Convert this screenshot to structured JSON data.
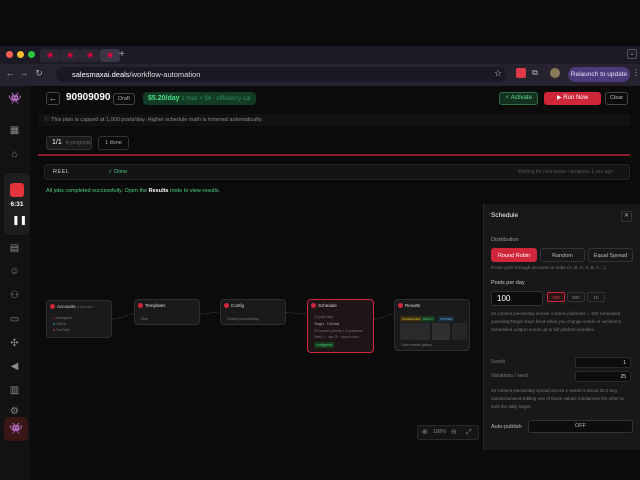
{
  "browser": {
    "domain": "salesmaxai.deals",
    "path": "/workflow-automation",
    "relaunch": "Relaunch to update"
  },
  "recorder": {
    "time": "6:31"
  },
  "header": {
    "title": "90909090",
    "status": "Draft",
    "cost": "$5.20/day",
    "cost_note": "1 max × $4 · efficiency cal",
    "activate": "Activate",
    "run_now": "Run Now",
    "clear": "Clear"
  },
  "notice": "This plan is capped at 1,000 posts/day. Higher schedule math is trimmed automatically.",
  "jobs": {
    "count": "1/1",
    "count_sub": "in progress",
    "done": "1 done",
    "type": "REEL",
    "state": "Done",
    "waiting": "Waiting for next lease • progress 1 sec ago",
    "complete_pre": "All jobs completed successfully. Open the ",
    "complete_bold": "Results",
    "complete_post": " node to view results."
  },
  "nodes": {
    "accounts": "Accounts",
    "accounts_tag": "4 selected",
    "acc1": "Instagram",
    "acc2": "TikTok",
    "acc3": "YouTube",
    "templates": "Templates",
    "tmpl_body": "Reel",
    "config": "Config",
    "config_body": "Default post settings",
    "schedule": "Schedule",
    "sched_1": "To post /day",
    "sched_2": "Target · 100/day",
    "sched_3": "25 content pieces × 4 platforms",
    "sched_4": "Seed 1 · var 25 · round robin",
    "sched_badge": "configured",
    "results": "Results",
    "res_badge1": "SCHEDULED",
    "res_badge2": "DRAFT",
    "res_badge3": "POSTED",
    "res_caption": "Open results gallery"
  },
  "zoom": {
    "level": "100%"
  },
  "panel": {
    "title": "Schedule",
    "distribution": "Distribution",
    "opt1": "Round Robin",
    "opt2": "Random",
    "opt3": "Equal Spread",
    "dist_desc": "Posts cycle through accounts in order (A, B, C, A, B, C…).",
    "ppd_label": "Posts per day",
    "ppd_value": "100",
    "chip1": "100",
    "chip2": "500",
    "chip3": "1K",
    "calc_desc": "25 content pieces/day across 4 active platforms = 100 scheduled posts/dayTarget stays fixed when you change seeds or variations. Scheduled output rounds up to full platform bundles.",
    "seeds_label": "Seeds",
    "seeds_value": "1",
    "var_label": "Variations / seed",
    "var_value": "25",
    "var_desc": "25 content pieces/day spread across 1 seeds is about 25.0 avg variations/seed.Editing one of these values rebalances the other to hold the daily target.",
    "autopublish": "Auto-publish",
    "off": "OFF"
  },
  "colors": {
    "accent": "#d0263a",
    "success": "#47e08a"
  }
}
